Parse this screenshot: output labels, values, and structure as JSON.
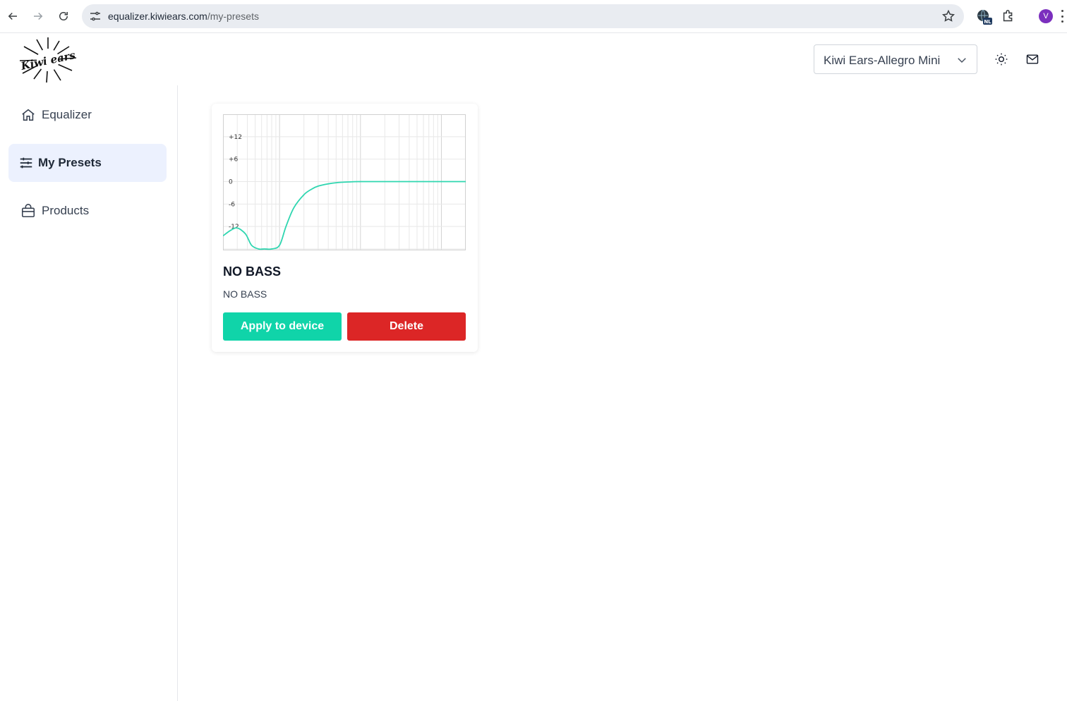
{
  "browser": {
    "url_host": "equalizer.kiwiears.com",
    "url_path": "/my-presets",
    "extension_badge": "NL",
    "profile_initial": "V",
    "icons": [
      "back-icon",
      "forward-icon",
      "reload-icon",
      "site-settings-icon",
      "bookmark-star-icon",
      "extension-globe-icon",
      "extensions-puzzle-icon",
      "chrome-menu-icon"
    ]
  },
  "header": {
    "logo_text": "Kiwi ears",
    "device_selected": "Kiwi Ears-Allegro Mini",
    "icons": [
      "theme-sun-icon",
      "mail-icon"
    ]
  },
  "sidebar": {
    "items": [
      {
        "label": "Equalizer",
        "icon": "home-icon",
        "active": false
      },
      {
        "label": "My Presets",
        "icon": "sliders-icon",
        "active": true
      },
      {
        "label": "Products",
        "icon": "shopping-bag-icon",
        "active": false
      }
    ]
  },
  "preset": {
    "title": "NO BASS",
    "description": "NO BASS",
    "apply_label": "Apply to device",
    "delete_label": "Delete"
  },
  "colors": {
    "accent": "#10d4a9",
    "curve": "#2fd6b0",
    "danger": "#dc2626",
    "active_bg": "#ecf1fe",
    "profile": "#7b2fbe"
  },
  "chart_data": {
    "type": "line",
    "title": "",
    "xlabel": "",
    "ylabel": "",
    "y_tick_labels": [
      "+12",
      "+6",
      "0",
      "-6",
      "-12"
    ],
    "y_ticks": [
      12,
      6,
      0,
      -6,
      -12
    ],
    "ylim": [
      -18,
      18
    ],
    "x_scale": "log",
    "xlim": [
      20,
      20000
    ],
    "grid": true,
    "legend": "none",
    "series": [
      {
        "x": [
          20,
          25,
          30,
          38,
          45,
          55,
          65,
          80,
          100,
          120,
          150,
          200,
          250,
          300,
          400,
          500,
          700,
          1000,
          2000,
          5000,
          10000,
          20000
        ],
        "values": [
          -14.5,
          -13,
          -12.4,
          -14,
          -17,
          -18,
          -18,
          -18,
          -17,
          -12,
          -7,
          -3.5,
          -2,
          -1.2,
          -0.6,
          -0.3,
          -0.1,
          0,
          0,
          0,
          0,
          0
        ]
      }
    ]
  }
}
